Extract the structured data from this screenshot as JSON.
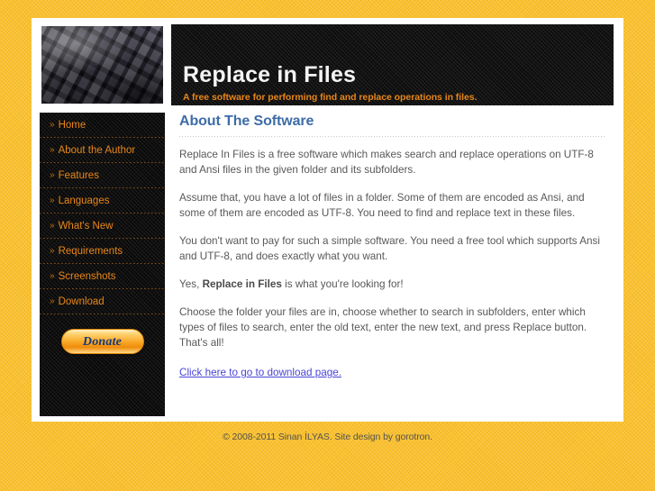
{
  "site": {
    "title": "Replace in Files",
    "tagline": "A free software for performing find and replace operations in files.",
    "logo_alt": "keyboard-photo"
  },
  "sidebar": {
    "bullet": "»",
    "items": [
      {
        "label": "Home"
      },
      {
        "label": "About the Author"
      },
      {
        "label": "Features"
      },
      {
        "label": "Languages"
      },
      {
        "label": "What's New"
      },
      {
        "label": "Requirements"
      },
      {
        "label": "Screenshots"
      },
      {
        "label": "Download"
      }
    ],
    "donate_label": "Donate"
  },
  "main": {
    "heading": "About The Software",
    "paragraph_1": "Replace In Files is a free software which makes search and replace operations on UTF-8 and Ansi files in the given folder and its subfolders.",
    "paragraph_2": "Assume that, you have a lot of files in a folder. Some of them are encoded as Ansi, and some of them are encoded as UTF-8. You need to find and replace text in these files.",
    "paragraph_3": "You don't want to pay for such a simple software. You need a free tool which supports Ansi and UTF-8, and does exactly what you want.",
    "paragraph_4_prefix": "Yes, ",
    "paragraph_4_bold": "Replace in Files",
    "paragraph_4_suffix": " is what you're looking for!",
    "paragraph_5": "Choose the folder your files are in, choose whether to search in subfolders, enter which types of files to search, enter the old text, enter the new text, and press Replace button. That's all!",
    "download_link": "Click here to go to download page."
  },
  "footer": {
    "text": "© 2008-2011 Sinan İLYAS. Site design by gorotron."
  },
  "colors": {
    "page_background": "#fbc02b",
    "panel": "#ffffff",
    "header": "#0c0c0c",
    "sidebar": "#080808",
    "accent_orange": "#e8861a",
    "heading_blue": "#3d6ca8",
    "body_text": "#58585a",
    "link_blue": "#4a44d6",
    "footer_text": "#55534e"
  }
}
